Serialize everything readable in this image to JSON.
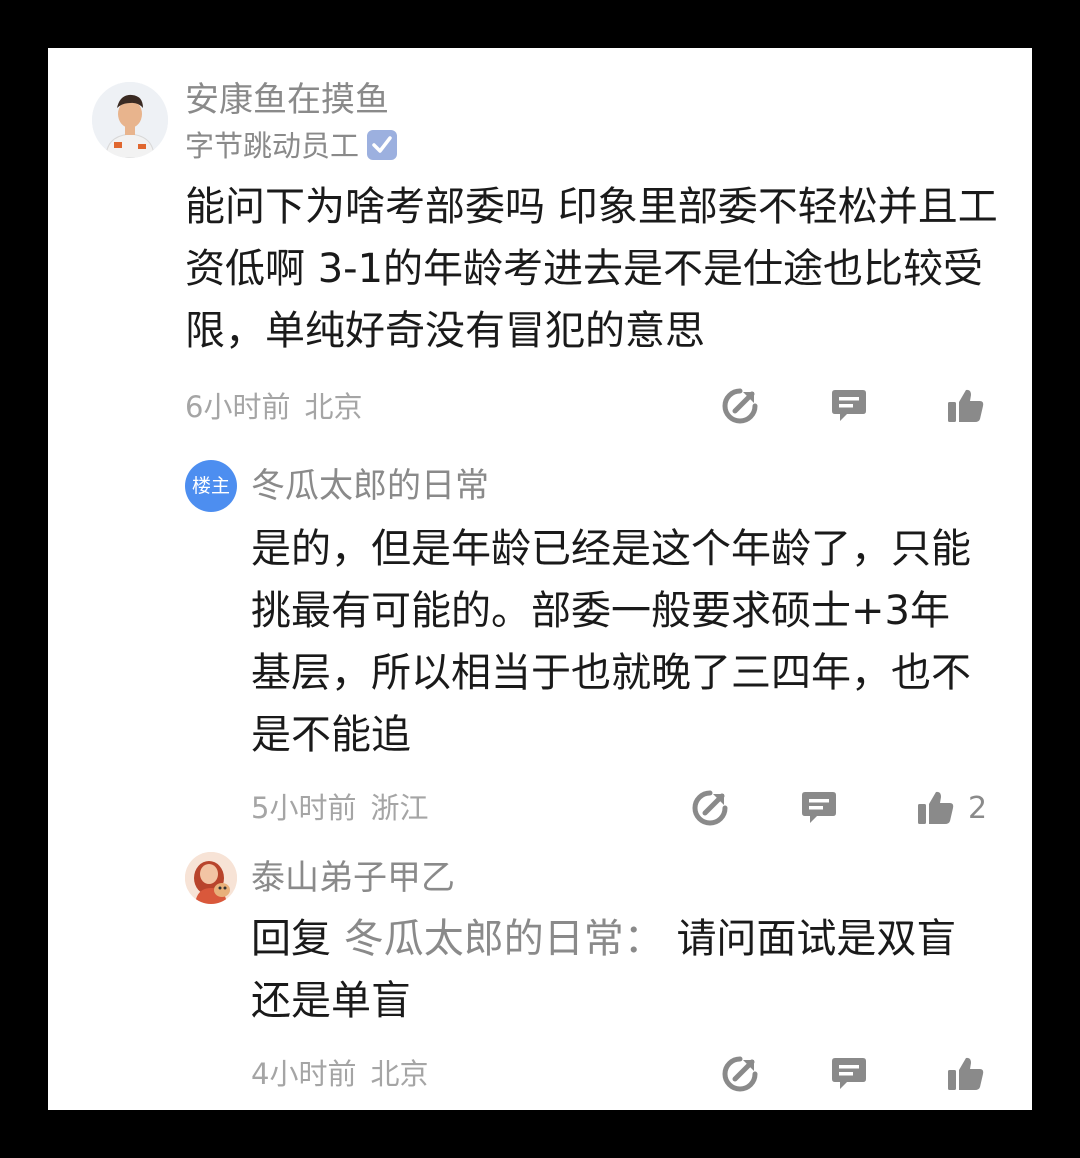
{
  "comment": {
    "author": "安康鱼在摸鱼",
    "author_title": "字节跳动员工",
    "verified_icon": "verified-check-icon",
    "text": "能问下为啥考部委吗 印象里部委不轻松并且工资低啊 3-1的年龄考进去是不是仕途也比较受限，单纯好奇没有冒犯的意思",
    "time": "6小时前",
    "location": "北京",
    "actions": [
      "share-icon",
      "comment-icon",
      "like-icon"
    ]
  },
  "replies": [
    {
      "badge": "楼主",
      "author": "冬瓜太郎的日常",
      "text": "是的，但是年龄已经是这个年龄了，只能挑最有可能的。部委一般要求硕士+3年基层，所以相当于也就晚了三四年，也不是不能追",
      "time": "5小时前",
      "location": "浙江",
      "like_count": "2"
    },
    {
      "author": "泰山弟子甲乙",
      "reply_prefix": "回复 ",
      "reply_to": "冬瓜太郎的日常：",
      "text": "请问面试是双盲还是单盲",
      "time": "4小时前",
      "location": "北京"
    }
  ],
  "colors": {
    "badge": "#4d8ef0",
    "meta": "#a5a5a5",
    "name": "#8a8a8a",
    "text": "#1a1a1a"
  }
}
